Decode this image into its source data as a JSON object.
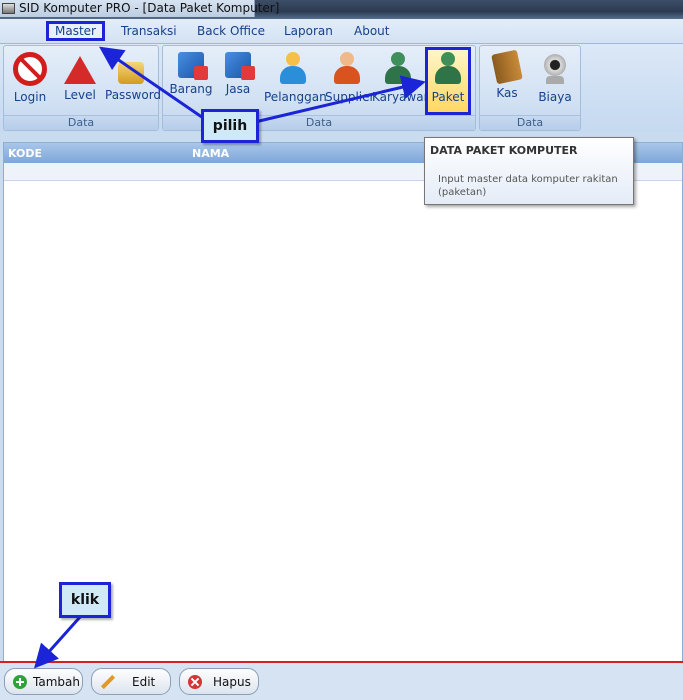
{
  "window": {
    "title": "SID Komputer PRO - [Data Paket Komputer]"
  },
  "menu": [
    "Master",
    "Transaksi",
    "Back Office",
    "Laporan",
    "About"
  ],
  "ribbon": {
    "groups": [
      {
        "label": "Data",
        "buttons": [
          {
            "label": "Login",
            "icon": "stop-icon"
          },
          {
            "label": "Level",
            "icon": "warning-icon"
          },
          {
            "label": "Password",
            "icon": "lock-icon"
          }
        ]
      },
      {
        "label": "Data",
        "buttons": [
          {
            "label": "Barang",
            "icon": "cube-icon"
          },
          {
            "label": "Jasa",
            "icon": "cube-icon"
          },
          {
            "label": "Pelanggan",
            "icon": "person-icon"
          },
          {
            "label": "Supplier",
            "icon": "person-icon"
          },
          {
            "label": "Karyawan",
            "icon": "people-icon"
          },
          {
            "label": "Paket",
            "icon": "people-icon"
          }
        ]
      },
      {
        "label": "Data",
        "buttons": [
          {
            "label": "Kas",
            "icon": "book-icon"
          },
          {
            "label": "Biaya",
            "icon": "webcam-icon"
          }
        ]
      }
    ]
  },
  "grid": {
    "columns": [
      "KODE",
      "NAMA"
    ]
  },
  "tooltip": {
    "title": "DATA PAKET KOMPUTER",
    "body": "Input master data komputer rakitan (paketan)"
  },
  "footer": {
    "buttons": [
      "Tambah",
      "Edit",
      "Hapus"
    ]
  },
  "callouts": {
    "pilih": "pilih",
    "klik": "klik"
  },
  "colors": {
    "highlight_border": "#1b24d6",
    "grid_header": "#7ea6d8",
    "divider": "#d32020"
  }
}
